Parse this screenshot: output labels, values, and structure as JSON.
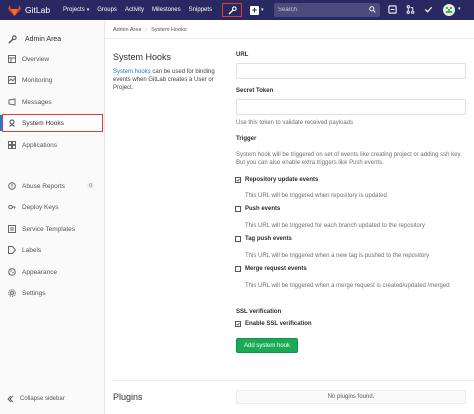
{
  "navbar": {
    "brand": "GitLab",
    "projects": "Projects",
    "groups": "Groups",
    "activity": "Activity",
    "milestones": "Milestones",
    "snippets": "Snippets",
    "search_placeholder": "Search",
    "colors": {
      "background": "#292961",
      "fox": "#e24329"
    }
  },
  "sidebar": {
    "header": "Admin Area",
    "items": [
      {
        "label": "Overview",
        "icon": "overview-icon"
      },
      {
        "label": "Monitoring",
        "icon": "monitoring-icon"
      },
      {
        "label": "Messages",
        "icon": "messages-icon"
      },
      {
        "label": "System Hooks",
        "icon": "hook-icon",
        "active": true
      },
      {
        "label": "Applications",
        "icon": "applications-icon"
      },
      {
        "label": "Abuse Reports",
        "icon": "abuse-icon",
        "badge": "0"
      },
      {
        "label": "Deploy Keys",
        "icon": "key-icon"
      },
      {
        "label": "Service Templates",
        "icon": "template-icon"
      },
      {
        "label": "Labels",
        "icon": "label-icon"
      },
      {
        "label": "Appearance",
        "icon": "appearance-icon"
      },
      {
        "label": "Settings",
        "icon": "settings-icon"
      }
    ],
    "collapse": "Collapse sidebar"
  },
  "breadcrumb": {
    "parent": "Admin Area",
    "current": "System Hooks"
  },
  "page": {
    "title": "System Hooks",
    "desc_link": "System hooks",
    "desc_text": " can be used for binding events when GitLab creates a User or Project."
  },
  "form": {
    "url_label": "URL",
    "url_value": "",
    "token_label": "Secret Token",
    "token_value": "",
    "token_help": "Use this token to validate received payloads",
    "trigger_label": "Trigger",
    "trigger_help": "System hook will be triggered on set of events like creating project or adding ssh key. But you can also enable extra triggers like Push events.",
    "triggers": [
      {
        "label": "Repository update events",
        "help": "This URL will be triggered when repository is updated",
        "checked": true
      },
      {
        "label": "Push events",
        "help": "This URL will be triggered for each branch updated to the repository",
        "checked": false
      },
      {
        "label": "Tag push events",
        "help": "This URL will be triggered when a new tag is pushed to the repository",
        "checked": false
      },
      {
        "label": "Merge request events",
        "help": "This URL will be triggered when a merge request is created/updated /merged",
        "checked": false
      }
    ],
    "ssl_label": "SSL verification",
    "ssl_checkbox": "Enable SSL verification",
    "ssl_checked": true,
    "submit": "Add system hook",
    "submit_color": "#1aaa55"
  },
  "plugins": {
    "title": "Plugins",
    "empty": "No plugins found."
  }
}
